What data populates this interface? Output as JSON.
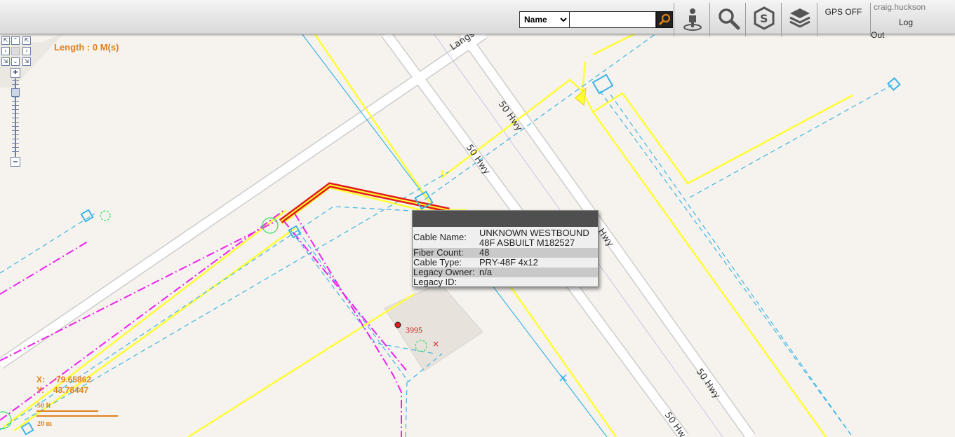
{
  "toolbar": {
    "search_mode": "Name",
    "search_options": [
      "Name"
    ],
    "search_placeholder": "",
    "tools": [
      {
        "name": "street-view"
      },
      {
        "name": "search"
      },
      {
        "name": "snap"
      },
      {
        "name": "layers"
      }
    ],
    "gps_label": "GPS OFF",
    "user": "craig.huckson",
    "logout_line1": "Log",
    "logout_line2": "Out"
  },
  "measure": {
    "length_label": "Length : 0 M(s)"
  },
  "coordinates": {
    "x_label": "X:",
    "x_value": "-79.65862",
    "y_label": "Y:",
    "y_value": "43.78447"
  },
  "scale": {
    "top_label": "50 ft",
    "bottom_label": "20 m"
  },
  "map_labels": {
    "street_langs": "Langs",
    "hwy": "50 Hwy",
    "hwy_partial": "Hwy",
    "hwy_bottom": "50 Hw",
    "point_id": "3995"
  },
  "popup": {
    "rows": [
      {
        "key": "Cable Name:",
        "value_line1": "UNKNOWN WESTBOUND",
        "value_line2": "48F ASBUILT M182527"
      },
      {
        "key": "Fiber Count:",
        "value": "48"
      },
      {
        "key": "Cable Type:",
        "value": "PRY-48F 4x12"
      },
      {
        "key": "Legacy Owner:",
        "value": "n/a"
      },
      {
        "key": "Legacy ID:",
        "value": ""
      }
    ]
  },
  "colors": {
    "road_outline": "#ffff33",
    "fiber_route": "#3cb4e6",
    "conduit": "#ee22ee",
    "selected_cable": "#e31a1c",
    "accent": "#e0801c"
  }
}
